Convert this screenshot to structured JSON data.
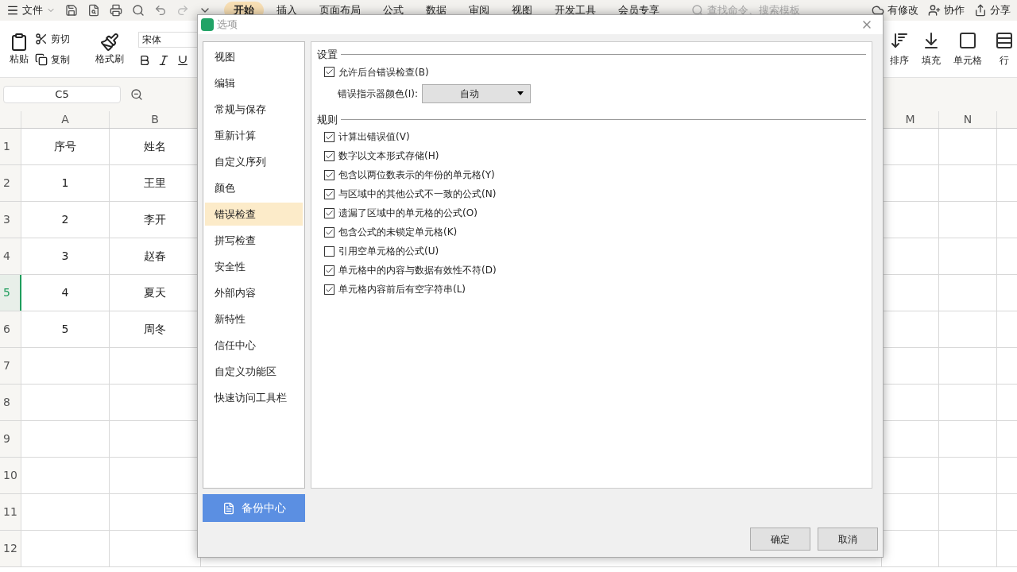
{
  "menu": {
    "label": "文件"
  },
  "tabs": [
    {
      "label": "开始",
      "selected": true
    },
    {
      "label": "插入",
      "selected": false
    },
    {
      "label": "页面布局",
      "selected": false
    },
    {
      "label": "公式",
      "selected": false
    },
    {
      "label": "数据",
      "selected": false
    },
    {
      "label": "审阅",
      "selected": false
    },
    {
      "label": "视图",
      "selected": false
    },
    {
      "label": "开发工具",
      "selected": false
    },
    {
      "label": "会员专享",
      "selected": false
    }
  ],
  "search": {
    "placeholder": "查找命令、搜索模板"
  },
  "header_actions": [
    {
      "kind": "cloud",
      "label": "有修改"
    },
    {
      "kind": "share_user",
      "label": "协作"
    },
    {
      "kind": "share",
      "label": "分享"
    }
  ],
  "ribbon": {
    "paste": "粘贴",
    "cut": "剪切",
    "copy": "复制",
    "format_painter": "格式刷",
    "font": {
      "value": "宋体"
    },
    "right_tools": [
      {
        "kind": "sort",
        "label": "排序"
      },
      {
        "kind": "fill",
        "label": "填充"
      },
      {
        "kind": "cell",
        "label": "单元格"
      },
      {
        "kind": "row",
        "label": "行"
      }
    ]
  },
  "name_box": {
    "value": "C5"
  },
  "sheet": {
    "columns": [
      "A",
      "B",
      "M",
      "N"
    ],
    "rows": [
      {
        "number": "1",
        "selected": false,
        "cells": [
          "序号",
          "姓名"
        ]
      },
      {
        "number": "2",
        "selected": false,
        "cells": [
          "1",
          "王里"
        ]
      },
      {
        "number": "3",
        "selected": false,
        "cells": [
          "2",
          "李开"
        ]
      },
      {
        "number": "4",
        "selected": false,
        "cells": [
          "3",
          "赵春"
        ]
      },
      {
        "number": "5",
        "selected": true,
        "cells": [
          "4",
          "夏天"
        ]
      },
      {
        "number": "6",
        "selected": false,
        "cells": [
          "5",
          "周冬"
        ]
      },
      {
        "number": "7",
        "selected": false
      },
      {
        "number": "8",
        "selected": false
      },
      {
        "number": "9",
        "selected": false
      },
      {
        "number": "10",
        "selected": false
      },
      {
        "number": "11",
        "selected": false
      },
      {
        "number": "12",
        "selected": false
      }
    ]
  },
  "dialog": {
    "title": "选项",
    "nav": [
      {
        "label": "视图",
        "selected": false
      },
      {
        "label": "编辑",
        "selected": false
      },
      {
        "label": "常规与保存",
        "selected": false
      },
      {
        "label": "重新计算",
        "selected": false
      },
      {
        "label": "自定义序列",
        "selected": false
      },
      {
        "label": "颜色",
        "selected": false
      },
      {
        "label": "错误检查",
        "selected": true
      },
      {
        "label": "拼写检查",
        "selected": false
      },
      {
        "label": "安全性",
        "selected": false
      },
      {
        "label": "外部内容",
        "selected": false
      },
      {
        "label": "新特性",
        "selected": false
      },
      {
        "label": "信任中心",
        "selected": false
      },
      {
        "label": "自定义功能区",
        "selected": false
      },
      {
        "label": "快速访问工具栏",
        "selected": false
      }
    ],
    "backup_button": "备份中心",
    "sections": [
      {
        "title": "设置",
        "items": [
          {
            "kind": "checkbox",
            "label": "允许后台错误检查(B)",
            "checked": true
          },
          {
            "kind": "dropdown",
            "label": "错误指示器颜色(I):",
            "value": "自动"
          }
        ]
      },
      {
        "title": "规则",
        "items": [
          {
            "kind": "checkbox",
            "label": "计算出错误值(V)",
            "checked": true
          },
          {
            "kind": "checkbox",
            "label": "数字以文本形式存储(H)",
            "checked": true
          },
          {
            "kind": "checkbox",
            "label": "包含以两位数表示的年份的单元格(Y)",
            "checked": true
          },
          {
            "kind": "checkbox",
            "label": "与区域中的其他公式不一致的公式(N)",
            "checked": true
          },
          {
            "kind": "checkbox",
            "label": "遗漏了区域中的单元格的公式(O)",
            "checked": true
          },
          {
            "kind": "checkbox",
            "label": "包含公式的未锁定单元格(K)",
            "checked": true
          },
          {
            "kind": "checkbox",
            "label": "引用空单元格的公式(U)",
            "checked": false
          },
          {
            "kind": "checkbox",
            "label": "单元格中的内容与数据有效性不符(D)",
            "checked": true
          },
          {
            "kind": "checkbox",
            "label": "单元格内容前后有空字符串(L)",
            "checked": true
          }
        ]
      }
    ],
    "buttons": [
      "确定",
      "取消"
    ]
  }
}
